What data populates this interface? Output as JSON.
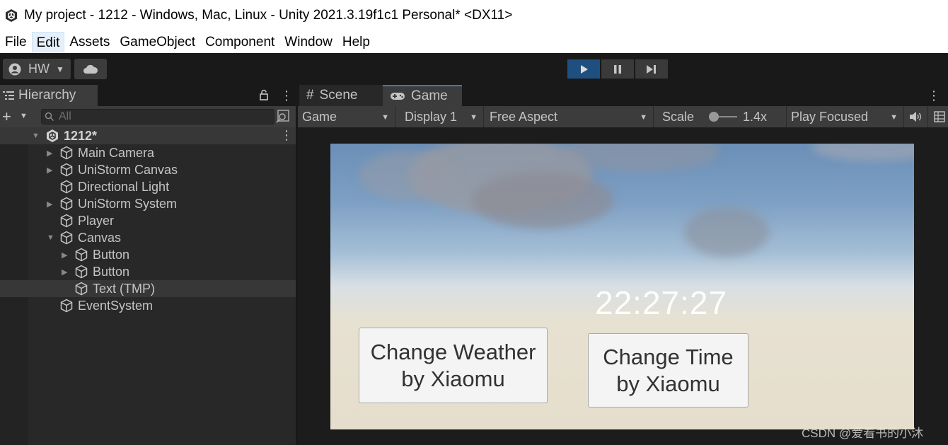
{
  "window": {
    "title": "My project - 1212 - Windows, Mac, Linux - Unity 2021.3.19f1c1 Personal* <DX11>",
    "logo_icon": "unity-logo-icon"
  },
  "menu": [
    "File",
    "Edit",
    "Assets",
    "GameObject",
    "Component",
    "Window",
    "Help"
  ],
  "menu_active": "Edit",
  "toolbar": {
    "account_label": "HW",
    "account_icon": "user-circle-icon",
    "cloud_icon": "cloud-icon",
    "play_icon": "play-icon",
    "pause_icon": "pause-icon",
    "step_icon": "step-icon",
    "play_active_color": "#1f4f7f"
  },
  "hierarchy": {
    "tab_label": "Hierarchy",
    "search_placeholder": "All",
    "scene_name": "1212*",
    "items": [
      {
        "name": "Main Camera",
        "expandable": true,
        "depth": 1
      },
      {
        "name": "UniStorm Canvas",
        "expandable": true,
        "depth": 1
      },
      {
        "name": "Directional Light",
        "expandable": false,
        "depth": 1
      },
      {
        "name": "UniStorm System",
        "expandable": true,
        "depth": 1
      },
      {
        "name": "Player",
        "expandable": false,
        "depth": 1
      },
      {
        "name": "Canvas",
        "expandable": true,
        "expanded": true,
        "depth": 1
      },
      {
        "name": "Button",
        "expandable": true,
        "depth": 2
      },
      {
        "name": "Button",
        "expandable": true,
        "depth": 2
      },
      {
        "name": "Text (TMP)",
        "expandable": false,
        "depth": 2,
        "selected": true
      },
      {
        "name": "EventSystem",
        "expandable": false,
        "depth": 1
      }
    ]
  },
  "game_panel": {
    "tabs": [
      {
        "label": "Scene",
        "icon": "grid-icon"
      },
      {
        "label": "Game",
        "icon": "gamepad-icon",
        "active": true
      }
    ],
    "view_mode": "Game",
    "display": "Display 1",
    "aspect": "Free Aspect",
    "scale_label": "Scale",
    "scale_value": "1.4x",
    "play_mode": "Play Focused",
    "game_view": {
      "clock": "22:27:27",
      "button_weather": [
        "Change Weather",
        "by Xiaomu"
      ],
      "button_time": [
        "Change Time",
        "by Xiaomu"
      ]
    }
  },
  "watermark": "CSDN @爱看书的小沐"
}
